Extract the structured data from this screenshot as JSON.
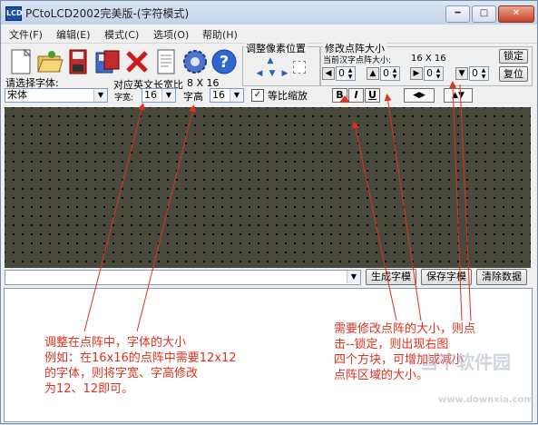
{
  "window": {
    "title": "PCtoLCD2002完美版-(字符模式)",
    "app_icon_text": "LCD"
  },
  "menu": [
    "文件(F)",
    "编辑(E)",
    "模式(C)",
    "选项(O)",
    "帮助(H)"
  ],
  "font_panel": {
    "choose_font_label": "请选择字体:",
    "font_value": "宋体",
    "char_width_label": "字宽:",
    "char_width_value": "16",
    "char_height_label": "字高",
    "char_height_value": "16",
    "ascii_width_label": "对应英文长宽比",
    "ascii_width_value": "8 X 16",
    "proportional_label": "等比缩放",
    "proportional_checked": true
  },
  "pixel_panel": {
    "title": "调整像素位置"
  },
  "matrix_panel": {
    "title": "修改点阵大小",
    "current_size_label": "当前汉字点阵大小:",
    "current_size_value": "16 X 16",
    "lock_label": "锁定",
    "reset_label": "复位",
    "spin_values": [
      "0",
      "0",
      "0",
      "0"
    ]
  },
  "format_buttons": [
    "B",
    "I",
    "U"
  ],
  "bottom_buttons": {
    "generate": "生成字模",
    "save": "保存字模",
    "clear": "清除数据"
  },
  "annotations": {
    "left": [
      "调整在点阵中，字体的大小",
      "例如：在16x16的点阵中需要12x12",
      "的字体，则将字宽、字高修改",
      "为12、12即可。"
    ],
    "right": [
      "需要修改点阵的大小，则点",
      "击--锁定，则出现右图",
      "四个方块，可增加或减小",
      "点阵区域的大小。"
    ]
  },
  "watermark": {
    "text1": "当下软件园",
    "text2": "www.downxia.com"
  }
}
